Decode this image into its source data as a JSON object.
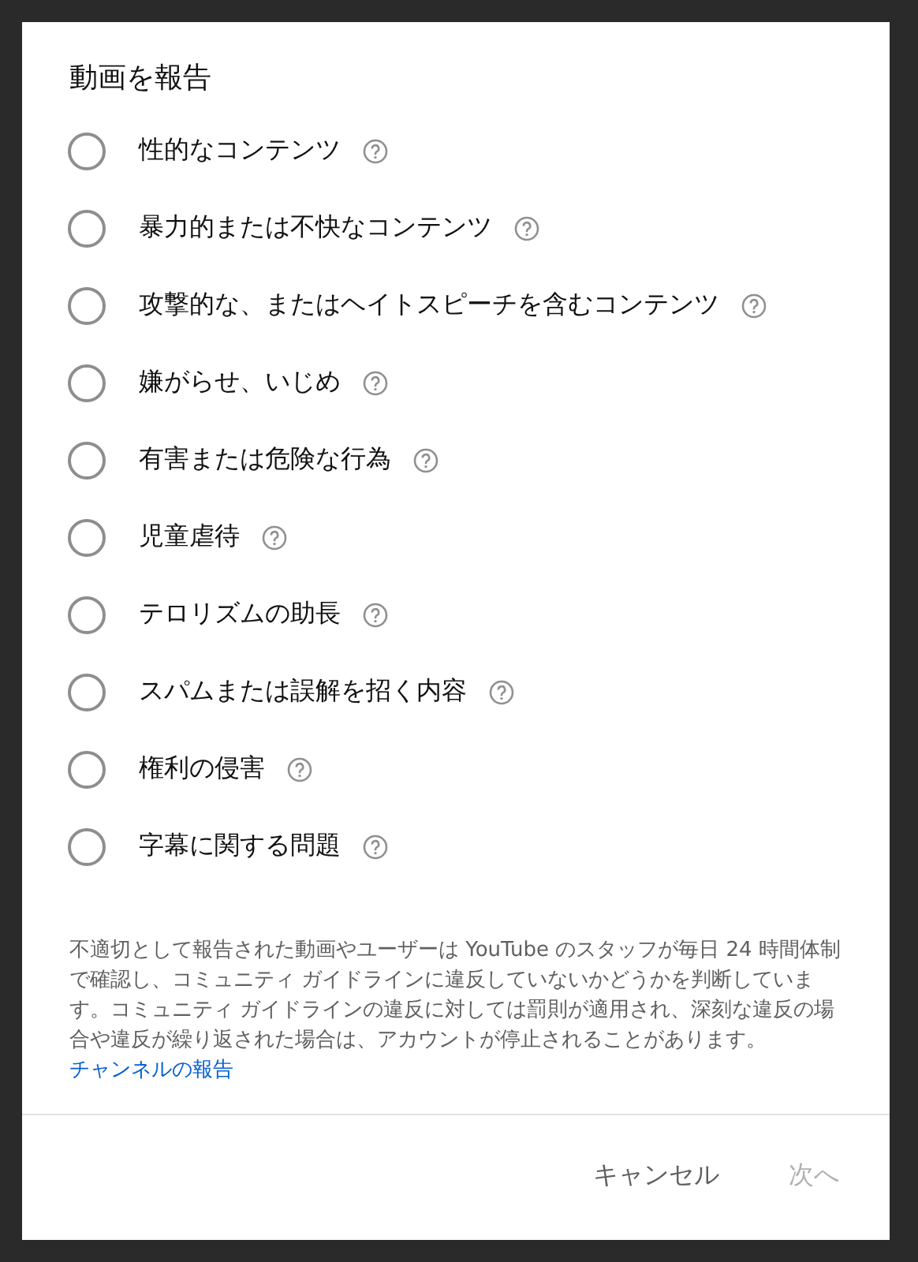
{
  "dialog": {
    "title": "動画を報告",
    "options": [
      {
        "label": "性的なコンテンツ",
        "selected": false
      },
      {
        "label": "暴力的または不快なコンテンツ",
        "selected": false
      },
      {
        "label": "攻撃的な、またはヘイトスピーチを含むコンテンツ",
        "selected": false
      },
      {
        "label": "嫌がらせ、いじめ",
        "selected": false
      },
      {
        "label": "有害または危険な行為",
        "selected": false
      },
      {
        "label": "児童虐待",
        "selected": false
      },
      {
        "label": "テロリズムの助長",
        "selected": false
      },
      {
        "label": "スパムまたは誤解を招く内容",
        "selected": false
      },
      {
        "label": "権利の侵害",
        "selected": false
      },
      {
        "label": "字幕に関する問題",
        "selected": false
      }
    ],
    "notice": "不適切として報告された動画やユーザーは YouTube のスタッフが毎日 24 時間体制で確認し、コミュニティ ガイドラインに違反していないかどうかを判断しています。コミュニティ ガイドラインの違反に対しては罰則が適用され、深刻な違反の場合や違反が繰り返された場合は、アカウントが停止されることがあります。",
    "notice_link": "チャンネルの報告",
    "buttons": [
      {
        "label": "キャンセル",
        "disabled": false
      },
      {
        "label": "次へ",
        "disabled": true
      }
    ]
  }
}
